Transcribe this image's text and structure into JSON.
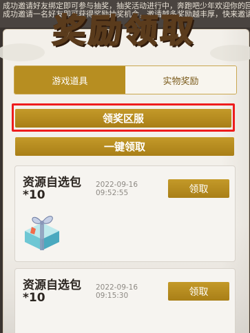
{
  "background_text": {
    "line1": "成功邀请好友绑定即可参与抽奖，抽奖活动进行中，奔跑吧少年欢迎你的回归！",
    "line2": "成功邀请一名好友即可获得奖励抽奖机会，邀请越多奖励越丰厚，快来邀请吧会。"
  },
  "header": {
    "title": "奖励领取"
  },
  "tabs": [
    {
      "label": "游戏道具",
      "active": true
    },
    {
      "label": "实物奖励",
      "active": false
    }
  ],
  "buttons": {
    "server_label": "领奖区服",
    "one_click_label": "一键领取"
  },
  "rewards": [
    {
      "name_line1": "资源自选包",
      "name_line2": "*10",
      "date": "2022-09-16",
      "time": "09:52:55",
      "claim_label": "领取",
      "icon": "gift-box-icon"
    },
    {
      "name_line1": "资源自选包",
      "name_line2": "*10",
      "date": "2022-09-16",
      "time": "09:15:30",
      "claim_label": "领取",
      "icon": "gift-box-icon"
    }
  ],
  "colors": {
    "gold": "#b78e21",
    "highlight_red": "#ee1c1c",
    "card_bg": "#f6f4f0"
  }
}
